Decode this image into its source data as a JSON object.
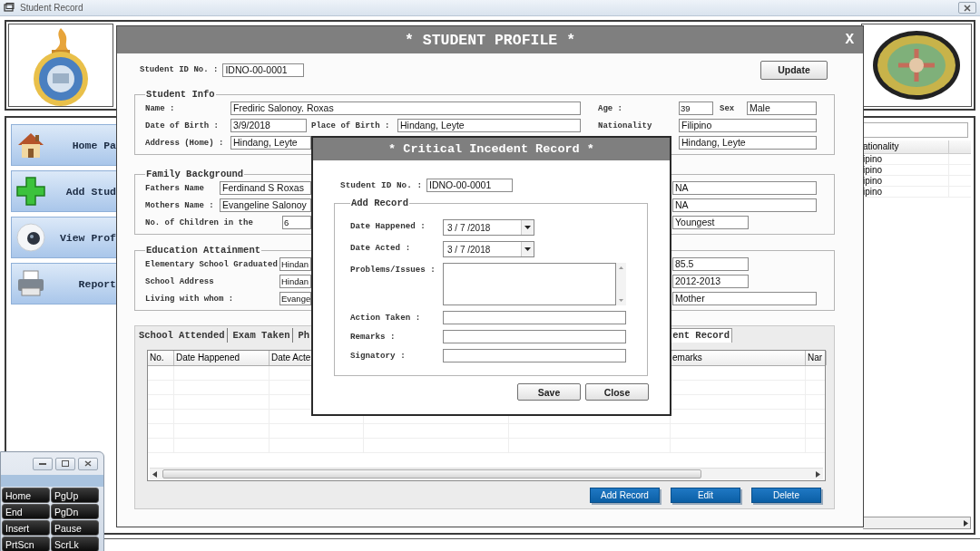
{
  "window": {
    "title": "Student Record"
  },
  "sidebar": {
    "items": [
      {
        "kind": "home",
        "label": "Home Pa"
      },
      {
        "kind": "add",
        "label": "Add Stud"
      },
      {
        "kind": "view",
        "label": "View Prof"
      },
      {
        "kind": "report",
        "label": "Report"
      }
    ]
  },
  "student_list": {
    "column_1": "ationality",
    "rows": [
      "ipino",
      "ipino",
      "ipino",
      "ipino"
    ]
  },
  "profile": {
    "title": "* STUDENT PROFILE *",
    "close": "X",
    "student_id": {
      "label": "Student ID No. :",
      "value": "IDNO-00-0001"
    },
    "update_button": "Update",
    "groups": [
      {
        "title": "Student Info",
        "fields": [
          {
            "label": "Name :",
            "value": "Frediric Salonoy. Roxas"
          },
          {
            "label": "Age :",
            "value": "39"
          },
          {
            "label": "Sex",
            "value": "Male"
          },
          {
            "label": "Date of Birth :",
            "value": "3/9/2018"
          },
          {
            "label": "Place of Birth :",
            "value": "Hindang, Leyte"
          },
          {
            "label": "Nationality",
            "value": "Filipino"
          },
          {
            "label": "Address (Home) :",
            "value": "Hindang, Leyte"
          },
          {
            "value": "Hindang, Leyte"
          }
        ]
      },
      {
        "title": "Family Background",
        "fields": [
          {
            "label": "Fathers Name",
            "value": "Ferdinand S Roxas"
          },
          {
            "value": "NA"
          },
          {
            "label": "Mothers Name :",
            "value": "Evangeline Salonoy"
          },
          {
            "value": "NA"
          },
          {
            "label": "No. of Children in the",
            "value": "6"
          },
          {
            "value": "Youngest"
          }
        ]
      },
      {
        "title": "Education Attainment",
        "fields": [
          {
            "label": "Elementary School Graduated",
            "value": "Hindan"
          },
          {
            "value": "85.5"
          },
          {
            "label": "School Address",
            "value": "Hindan"
          },
          {
            "value": "2012-2013"
          },
          {
            "label": "Living with whom :",
            "value": "Evange"
          },
          {
            "value": "Mother"
          }
        ]
      }
    ],
    "tabs": [
      {
        "label": "School Attended",
        "selected": false
      },
      {
        "label": "Exam Taken",
        "selected": false
      },
      {
        "label": "Ph",
        "selected": false
      },
      {
        "label": "ent Record",
        "selected": true
      }
    ],
    "table": {
      "columns": [
        "No.",
        "Date Happened",
        "Date Acte",
        "emarks",
        "Nar"
      ]
    },
    "buttons": [
      "Add Record",
      "Edit",
      "Delete"
    ]
  },
  "incident_dialog": {
    "title": "* Critical Incedent Record *",
    "student_id": {
      "label": "Student ID No. :",
      "value": "IDNO-00-0001"
    },
    "group_title": "Add Record",
    "rows": [
      {
        "kind": "date",
        "label": "Date Happened :",
        "value": "3 / 7 /2018"
      },
      {
        "kind": "date",
        "label": "Date Acted :",
        "value": "3 / 7 /2018"
      },
      {
        "kind": "multiline",
        "label": "Problems/Issues :"
      },
      {
        "kind": "text",
        "label": "Action Taken :"
      },
      {
        "kind": "text",
        "label": "Remarks :"
      },
      {
        "kind": "text",
        "label": "Signatory :"
      }
    ],
    "buttons": [
      "Save",
      "Close"
    ]
  },
  "keyboard": {
    "keys": [
      "Home",
      "PgUp",
      "End",
      "PgDn",
      "Insert",
      "Pause",
      "PrtScn",
      "ScrLk"
    ]
  }
}
